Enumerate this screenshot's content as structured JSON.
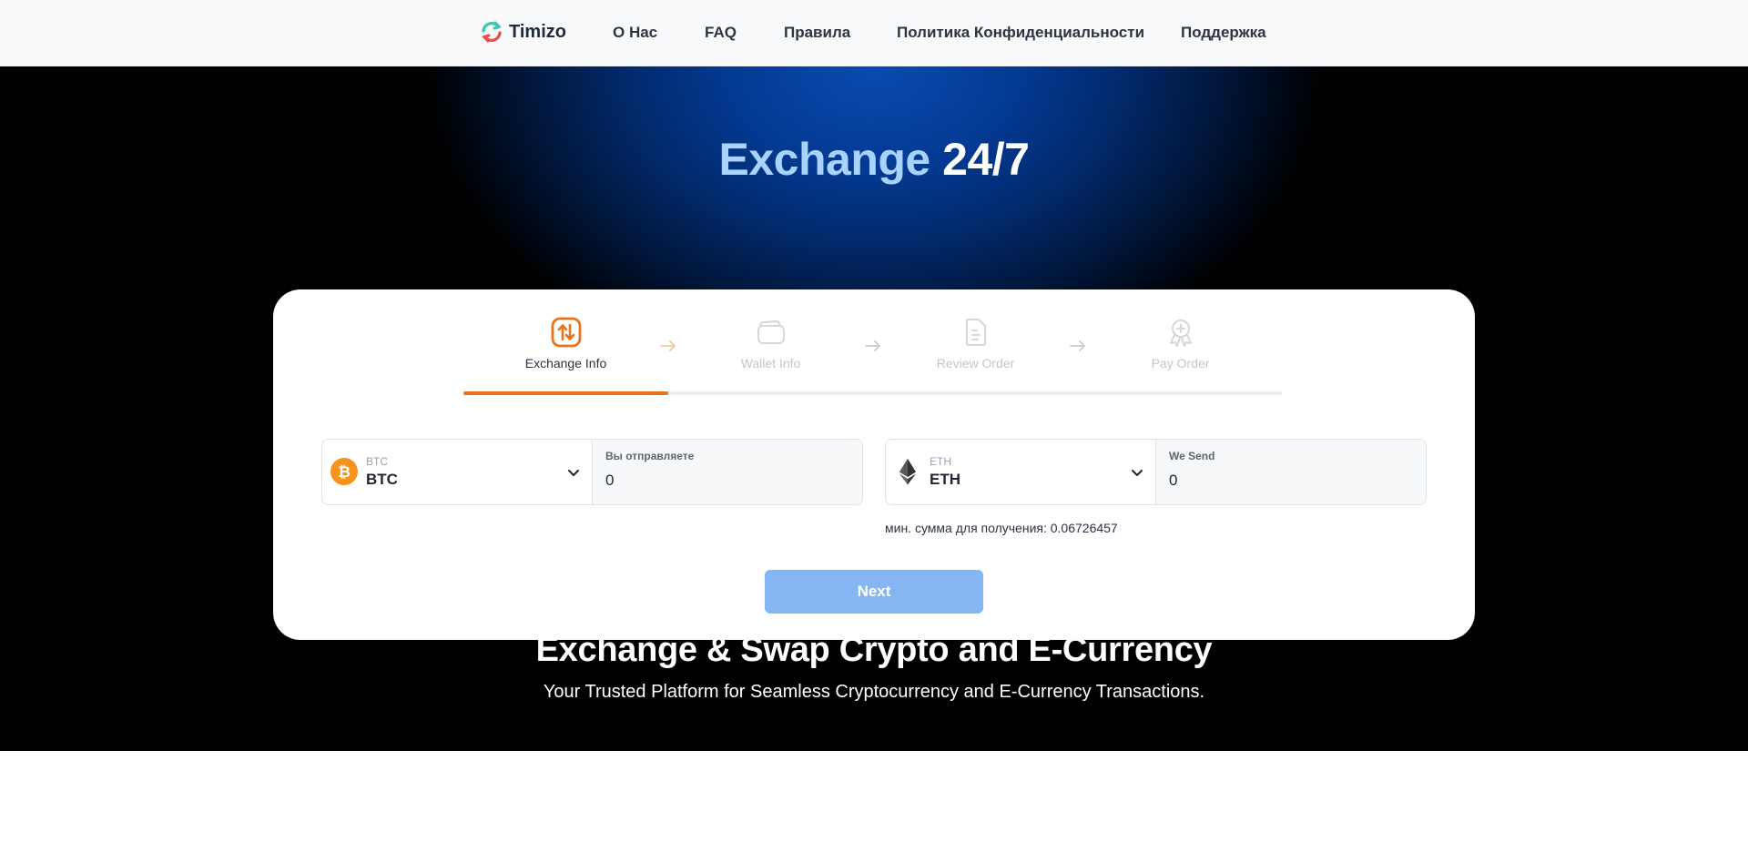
{
  "nav": {
    "brand": "Timizo",
    "links": [
      "О Нас",
      "FAQ",
      "Правила",
      "Политика Конфиденциальности",
      "Поддержка"
    ]
  },
  "hero": {
    "title_part1": "Exchange",
    "title_part2": "24/7"
  },
  "steps": [
    {
      "label": "Exchange Info",
      "icon": "exchange-arrows-icon",
      "active": true
    },
    {
      "label": "Wallet Info",
      "icon": "wallet-icon",
      "active": false
    },
    {
      "label": "Review Order",
      "icon": "document-icon",
      "active": false
    },
    {
      "label": "Pay Order",
      "icon": "award-badge-icon",
      "active": false
    }
  ],
  "progress": 0.25,
  "send": {
    "coin_small": "BTC",
    "coin_name": "BTC",
    "amount_label": "Вы отправляете",
    "amount_value": "0"
  },
  "receive": {
    "coin_small": "ETH",
    "coin_name": "ETH",
    "amount_label": "We Send",
    "amount_value": "0"
  },
  "min_note": "мин. сумма для получения: 0.06726457",
  "next_label": "Next",
  "section": {
    "title": "Exchange & Swap Crypto and E-Currency",
    "subtitle": "Your Trusted Platform for Seamless Cryptocurrency and E-Currency Transactions."
  },
  "colors": {
    "accent_orange": "#e8731c",
    "next_button": "#86b5f4",
    "hero_blue": "#0a4bb0",
    "hero_title_blue": "#a9d3ff"
  }
}
